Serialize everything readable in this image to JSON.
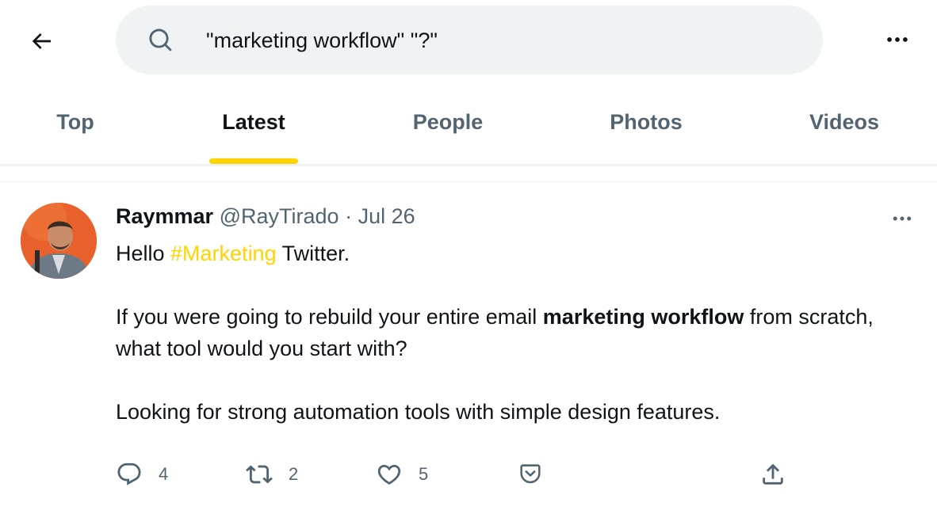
{
  "search": {
    "query": "\"marketing workflow\" \"?\""
  },
  "tabs": [
    {
      "label": "Top"
    },
    {
      "label": "Latest"
    },
    {
      "label": "People"
    },
    {
      "label": "Photos"
    },
    {
      "label": "Videos"
    }
  ],
  "active_tab": "Latest",
  "accent_color": "#ffd400",
  "tweet": {
    "author_name": "Raymmar",
    "author_handle": "@RayTirado",
    "separator": "·",
    "date": "Jul 26",
    "line1_pre": "Hello ",
    "hashtag": "#Marketing",
    "line1_post": " Twitter.",
    "para2_pre": "If you were going to rebuild your entire email ",
    "para2_bold": "marketing workflow",
    "para2_post": " from scratch, what tool would you start with?",
    "para3": "Looking for strong automation tools with simple design features.",
    "stats": {
      "replies": "4",
      "retweets": "2",
      "likes": "5"
    }
  },
  "icons": {
    "back": "arrow-left-icon",
    "search": "search-icon",
    "more": "more-horizontal-icon",
    "reply": "reply-icon",
    "retweet": "retweet-icon",
    "like": "heart-icon",
    "bookmark": "pocket-icon",
    "share": "share-icon"
  }
}
